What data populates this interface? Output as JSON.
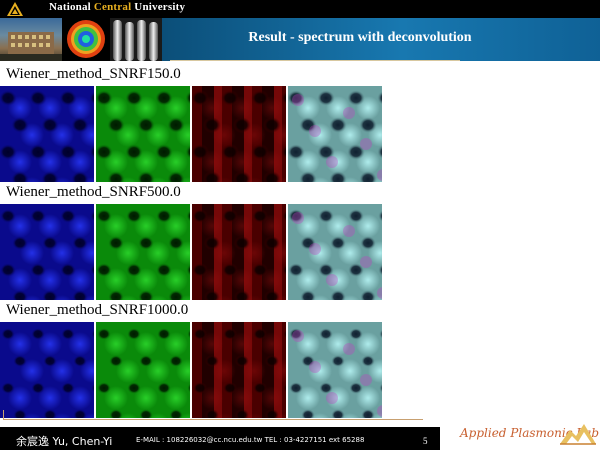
{
  "header": {
    "university_prefix": "National ",
    "university_central": "Central",
    "university_suffix": " University",
    "slide_title": "Result - spectrum with deconvolution"
  },
  "rows": [
    {
      "label": "Wiener_method_SNRF150.0"
    },
    {
      "label": "Wiener_method_SNRF500.0"
    },
    {
      "label": "Wiener_method_SNRF1000.0"
    }
  ],
  "channels": [
    {
      "name": "blue",
      "bg": "#0a0a8c",
      "fg": "#2a3aff",
      "dark": "#00002a"
    },
    {
      "name": "green",
      "bg": "#0a8a0a",
      "fg": "#30e030",
      "dark": "#001a00"
    },
    {
      "name": "red",
      "bg": "#4a0000",
      "fg": "#a01010",
      "dark": "#100000"
    },
    {
      "name": "composite",
      "bg": "#6aa0a0",
      "fg": "#c0ffff",
      "dark": "#102030"
    }
  ],
  "footer": {
    "author": "余宸逸 Yu, Chen-Yi",
    "contact": "E-MAIL : 108226032@cc.ncu.edu.tw     TEL : 03-4227151  ext 65288",
    "page": "5",
    "lab": "Applied Plasmonic Lab"
  },
  "colors": {
    "banner": "#0e5e8c",
    "accent_gold": "#e8b020",
    "footer_bg": "#000000"
  }
}
